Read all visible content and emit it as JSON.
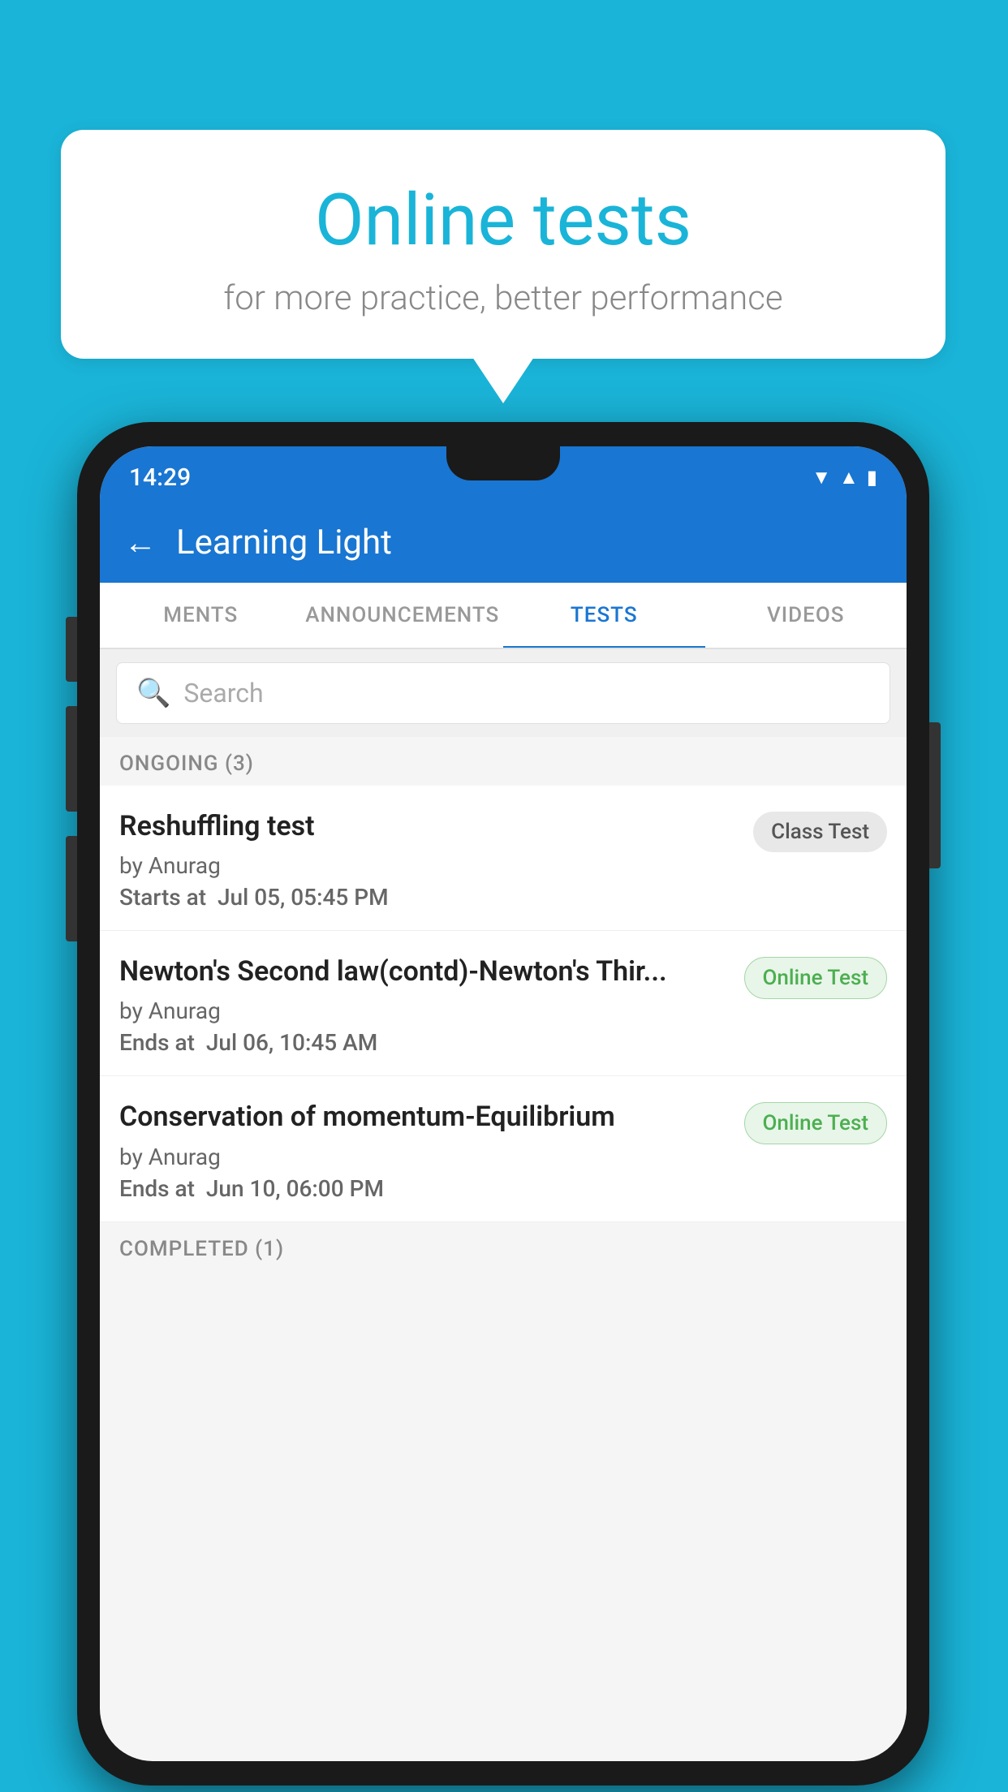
{
  "background": {
    "color": "#1ab4d8"
  },
  "speech_bubble": {
    "title": "Online tests",
    "subtitle": "for more practice, better performance"
  },
  "phone": {
    "status_bar": {
      "time": "14:29",
      "icons": [
        "wifi",
        "signal",
        "battery"
      ]
    },
    "app_bar": {
      "back_label": "←",
      "title": "Learning Light"
    },
    "tabs": [
      {
        "label": "MENTS",
        "active": false
      },
      {
        "label": "ANNOUNCEMENTS",
        "active": false
      },
      {
        "label": "TESTS",
        "active": true
      },
      {
        "label": "VIDEOS",
        "active": false
      }
    ],
    "search": {
      "placeholder": "Search"
    },
    "ongoing_section": {
      "header": "ONGOING (3)",
      "items": [
        {
          "title": "Reshuffling test",
          "by": "by Anurag",
          "date_label": "Starts at",
          "date": "Jul 05, 05:45 PM",
          "badge": "Class Test",
          "badge_type": "class"
        },
        {
          "title": "Newton's Second law(contd)-Newton's Thir...",
          "by": "by Anurag",
          "date_label": "Ends at",
          "date": "Jul 06, 10:45 AM",
          "badge": "Online Test",
          "badge_type": "online"
        },
        {
          "title": "Conservation of momentum-Equilibrium",
          "by": "by Anurag",
          "date_label": "Ends at",
          "date": "Jun 10, 06:00 PM",
          "badge": "Online Test",
          "badge_type": "online"
        }
      ]
    },
    "completed_section": {
      "header": "COMPLETED (1)"
    }
  }
}
